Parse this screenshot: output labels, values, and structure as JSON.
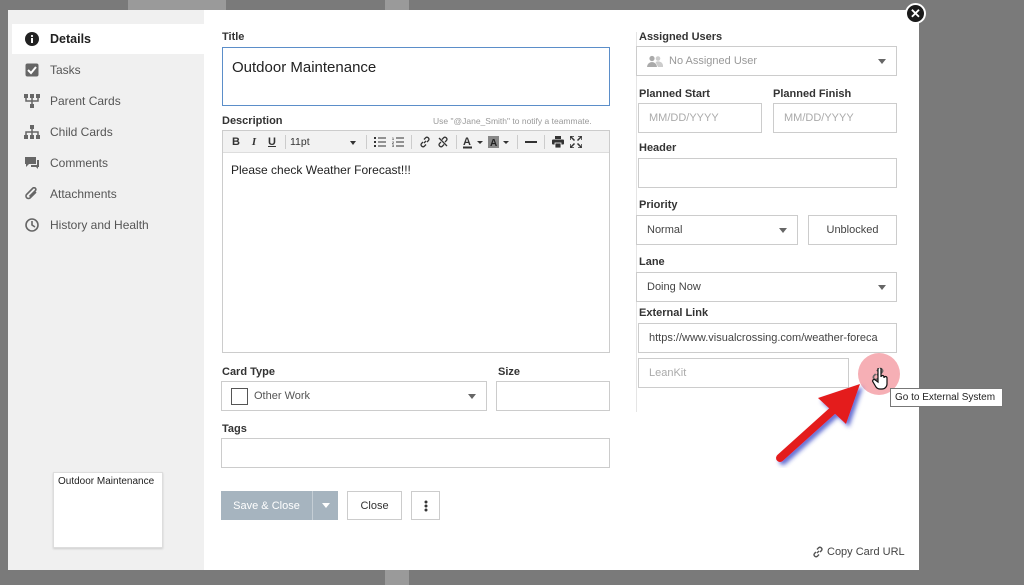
{
  "sidebar": {
    "items": [
      {
        "label": "Details",
        "icon": "info-icon"
      },
      {
        "label": "Tasks",
        "icon": "checkbox-icon"
      },
      {
        "label": "Parent Cards",
        "icon": "parent-cards-icon"
      },
      {
        "label": "Child Cards",
        "icon": "child-cards-icon"
      },
      {
        "label": "Comments",
        "icon": "comment-icon"
      },
      {
        "label": "Attachments",
        "icon": "paperclip-icon"
      },
      {
        "label": "History and Health",
        "icon": "history-icon"
      }
    ],
    "card_preview": "Outdoor Maintenance"
  },
  "form": {
    "title_label": "Title",
    "title_value": "Outdoor Maintenance",
    "description_label": "Description",
    "description_hint": "Use \"@Jane_Smith\" to notify a teammate.",
    "font_size": "11pt",
    "description_text": "Please check Weather Forecast!!!",
    "card_type_label": "Card Type",
    "card_type_value": "Other Work",
    "size_label": "Size",
    "tags_label": "Tags"
  },
  "right": {
    "assigned_users_label": "Assigned Users",
    "assigned_users_placeholder": "No Assigned User",
    "planned_start_label": "Planned Start",
    "planned_start_placeholder": "MM/DD/YYYY",
    "planned_finish_label": "Planned Finish",
    "planned_finish_placeholder": "MM/DD/YYYY",
    "header_label": "Header",
    "priority_label": "Priority",
    "priority_value": "Normal",
    "blocked_button": "Unblocked",
    "lane_label": "Lane",
    "lane_value": "Doing Now",
    "external_link_label": "External Link",
    "external_link_value": "https://www.visualcrossing.com/weather-foreca",
    "external_link_title_placeholder": "LeanKit"
  },
  "buttons": {
    "save_close": "Save & Close",
    "close": "Close",
    "copy_url": "Copy Card URL"
  },
  "tooltip": "Go to External System",
  "colors": {
    "accent": "#5b8ec9",
    "save_button": "#a6b4bf",
    "arrow": "#e41c1c"
  }
}
